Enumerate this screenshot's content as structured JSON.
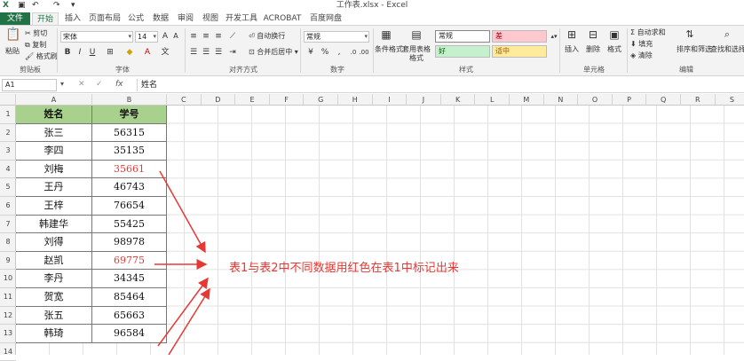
{
  "window": {
    "title": "工作表.xlsx - Excel"
  },
  "tabs": [
    "文件",
    "开始",
    "插入",
    "页面布局",
    "公式",
    "数据",
    "审阅",
    "视图",
    "开发工具",
    "ACROBAT",
    "百度网盘"
  ],
  "active_tab": "开始",
  "ribbon": {
    "clipboard": {
      "label": "剪贴板",
      "paste": "粘贴",
      "cut": "剪切",
      "copy": "复制",
      "painter": "格式刷"
    },
    "font": {
      "label": "字体",
      "name": "宋体",
      "size": "14"
    },
    "alignment": {
      "label": "对齐方式",
      "wrap": "自动换行",
      "merge": "合并后居中"
    },
    "number": {
      "label": "数字",
      "format": "常规"
    },
    "styles": {
      "label": "样式",
      "cond_format": "条件格式",
      "table_format": "套用表格格式",
      "normal": "常规",
      "bad": "差",
      "good": "好",
      "neutral": "适中"
    },
    "cells": {
      "label": "单元格",
      "insert": "插入",
      "delete": "删除",
      "format": "格式"
    },
    "editing": {
      "label": "编辑",
      "autosum": "自动求和",
      "fill": "填充",
      "clear": "清除",
      "sort": "排序和筛选",
      "find": "查找和选择"
    }
  },
  "formula_bar": {
    "name_box": "A1",
    "fx": "fx",
    "content": "姓名"
  },
  "columns": [
    "A",
    "B",
    "C",
    "D",
    "E",
    "F",
    "G",
    "H",
    "I",
    "J",
    "K",
    "L",
    "M",
    "N",
    "O",
    "P",
    "Q",
    "R",
    "S"
  ],
  "rows": [
    "1",
    "2",
    "3",
    "4",
    "5",
    "6",
    "7",
    "8",
    "9",
    "10",
    "11",
    "12",
    "13",
    "14"
  ],
  "table": {
    "headers": [
      "姓名",
      "学号"
    ],
    "rows": [
      {
        "name": "张三",
        "id": "56315",
        "red": false
      },
      {
        "name": "李四",
        "id": "35135",
        "red": false
      },
      {
        "name": "刘梅",
        "id": "35661",
        "red": true
      },
      {
        "name": "王丹",
        "id": "46743",
        "red": false
      },
      {
        "name": "王梓",
        "id": "76654",
        "red": false
      },
      {
        "name": "韩建华",
        "id": "55425",
        "red": false
      },
      {
        "name": "刘得",
        "id": "98978",
        "red": false
      },
      {
        "name": "赵凯",
        "id": "69775",
        "red": true
      },
      {
        "name": "李丹",
        "id": "34345",
        "red": false
      },
      {
        "name": "贺宽",
        "id": "85464",
        "red": false
      },
      {
        "name": "张五",
        "id": "65663",
        "red": false
      },
      {
        "name": "韩琦",
        "id": "96584",
        "red": false
      }
    ]
  },
  "annotation": "表1与表2中不同数据用红色在表1中标记出来",
  "colors": {
    "header_fill": "#a9d18e",
    "red": "#e53935",
    "excel_green": "#217346"
  }
}
